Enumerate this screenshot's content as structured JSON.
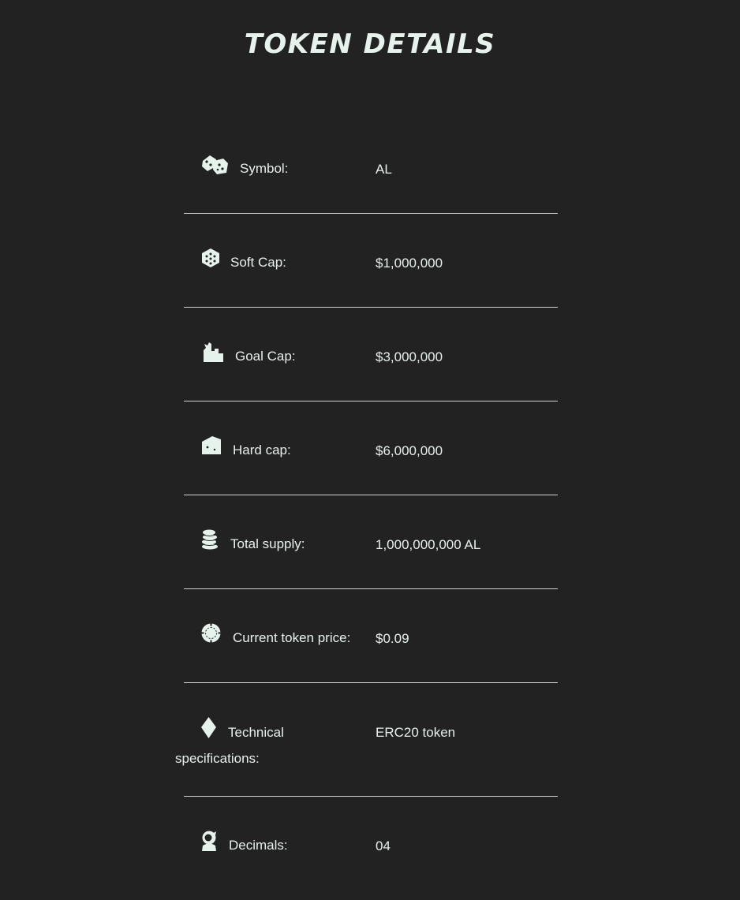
{
  "page": {
    "title": "TOKEN DETAILS"
  },
  "colors": {
    "background": "#222222",
    "text": "#e8f0ec",
    "divider": "#cfd6d2"
  },
  "rows": [
    {
      "icon": "dice-icon",
      "label": "Symbol:",
      "value": "AL"
    },
    {
      "icon": "cube-icon",
      "label": "Soft Cap:",
      "value": "$1,000,000"
    },
    {
      "icon": "castle-icon",
      "label": "Goal Cap:",
      "value": "$3,000,000"
    },
    {
      "icon": "cheese-icon",
      "label": "Hard cap:",
      "value": "$6,000,000"
    },
    {
      "icon": "coin-stack-icon",
      "label": "Total supply:",
      "value": "1,000,000,000 AL"
    },
    {
      "icon": "poker-chip-icon",
      "label": "Current token price:",
      "value": "$0.09"
    },
    {
      "icon": "diamond-icon",
      "label_line1": "Technical",
      "label_line2": "specifications:",
      "value": "ERC20 token"
    },
    {
      "icon": "astronaut-icon",
      "label": "Decimals:",
      "value": "04"
    }
  ]
}
